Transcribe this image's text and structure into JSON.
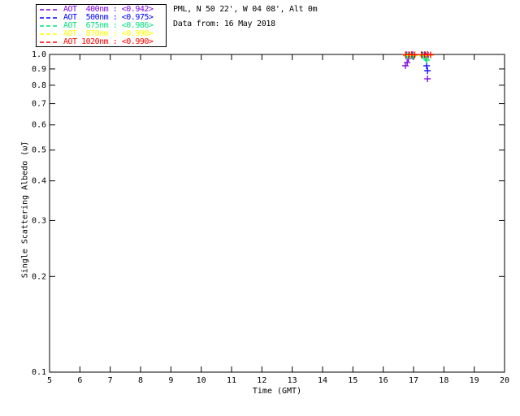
{
  "header": {
    "location_line": "PML, N 50 22', W 04 08', Alt 0m",
    "data_line": "Data from: 16 May 2018"
  },
  "legend": {
    "entries": [
      {
        "label": "AOT  400nm : <0.942>",
        "wavelength": "400nm",
        "mean": "<0.942>",
        "color": "#7D00DC"
      },
      {
        "label": "AOT  500nm : <0.975>",
        "wavelength": "500nm",
        "mean": "<0.975>",
        "color": "#0000FF"
      },
      {
        "label": "AOT  675nm : <0.986>",
        "wavelength": "675nm",
        "mean": "<0.986>",
        "color": "#00E07D"
      },
      {
        "label": "AOT  870nm : <0.990>",
        "wavelength": "870nm",
        "mean": "<0.990>",
        "color": "#FFFF00"
      },
      {
        "label": "AOT 1020nm : <0.990>",
        "wavelength": "1020nm",
        "mean": "<0.990>",
        "color": "#FF0000"
      }
    ]
  },
  "chart_data": {
    "type": "scatter",
    "title": "",
    "xlabel": "Time (GMT)",
    "ylabel": "Single Scattering Albedo (ω̃)",
    "xlim": [
      5,
      20
    ],
    "ylim": [
      0.1,
      1.0
    ],
    "yscale": "log",
    "grid": false,
    "legend_position": "top-left-outside",
    "marker": "+",
    "xticks": [
      5,
      6,
      7,
      8,
      9,
      10,
      11,
      12,
      13,
      14,
      15,
      16,
      17,
      18,
      19,
      20
    ],
    "yticks": [
      1.0,
      0.9,
      0.8,
      0.7,
      0.6,
      0.5,
      0.4,
      0.3,
      0.2,
      0.1
    ],
    "series": [
      {
        "name": "AOT 400nm",
        "mean": 0.942,
        "color": "#7D00DC",
        "points": [
          [
            16.73,
            0.921
          ],
          [
            16.79,
            0.943
          ],
          [
            16.83,
            0.971
          ],
          [
            16.78,
            0.997
          ],
          [
            16.88,
            0.995
          ],
          [
            16.98,
            0.998
          ],
          [
            17.28,
            0.996
          ],
          [
            17.38,
            0.998
          ],
          [
            17.48,
            0.995
          ],
          [
            17.46,
            0.838
          ]
        ]
      },
      {
        "name": "AOT 500nm",
        "mean": 0.975,
        "color": "#0000FF",
        "points": [
          [
            16.76,
            0.993
          ],
          [
            16.86,
            0.996
          ],
          [
            16.96,
            0.99
          ],
          [
            17.3,
            0.995
          ],
          [
            17.4,
            0.99
          ],
          [
            17.43,
            0.921
          ],
          [
            17.46,
            0.889
          ]
        ]
      },
      {
        "name": "AOT 675nm",
        "mean": 0.986,
        "color": "#00E07D",
        "points": [
          [
            16.78,
            0.99
          ],
          [
            16.88,
            0.992
          ],
          [
            16.98,
            0.988
          ],
          [
            17.3,
            0.99
          ],
          [
            17.4,
            0.971
          ],
          [
            17.44,
            0.96
          ]
        ]
      },
      {
        "name": "AOT 870nm",
        "mean": 0.99,
        "color": "#FFFF00",
        "points": [
          [
            16.74,
            0.996
          ],
          [
            16.84,
            0.993
          ],
          [
            16.94,
            0.997
          ],
          [
            17.04,
            0.994
          ],
          [
            17.26,
            0.995
          ],
          [
            17.36,
            0.996
          ],
          [
            17.46,
            0.993
          ],
          [
            17.56,
            0.995
          ]
        ]
      },
      {
        "name": "AOT 1020nm",
        "mean": 0.99,
        "color": "#FF0000",
        "points": [
          [
            16.74,
            0.999
          ],
          [
            16.84,
            0.998
          ],
          [
            16.94,
            1.0
          ],
          [
            17.04,
            0.997
          ],
          [
            17.26,
            0.999
          ],
          [
            17.36,
            0.998
          ],
          [
            17.46,
            1.0
          ],
          [
            17.56,
            0.997
          ]
        ]
      }
    ]
  }
}
